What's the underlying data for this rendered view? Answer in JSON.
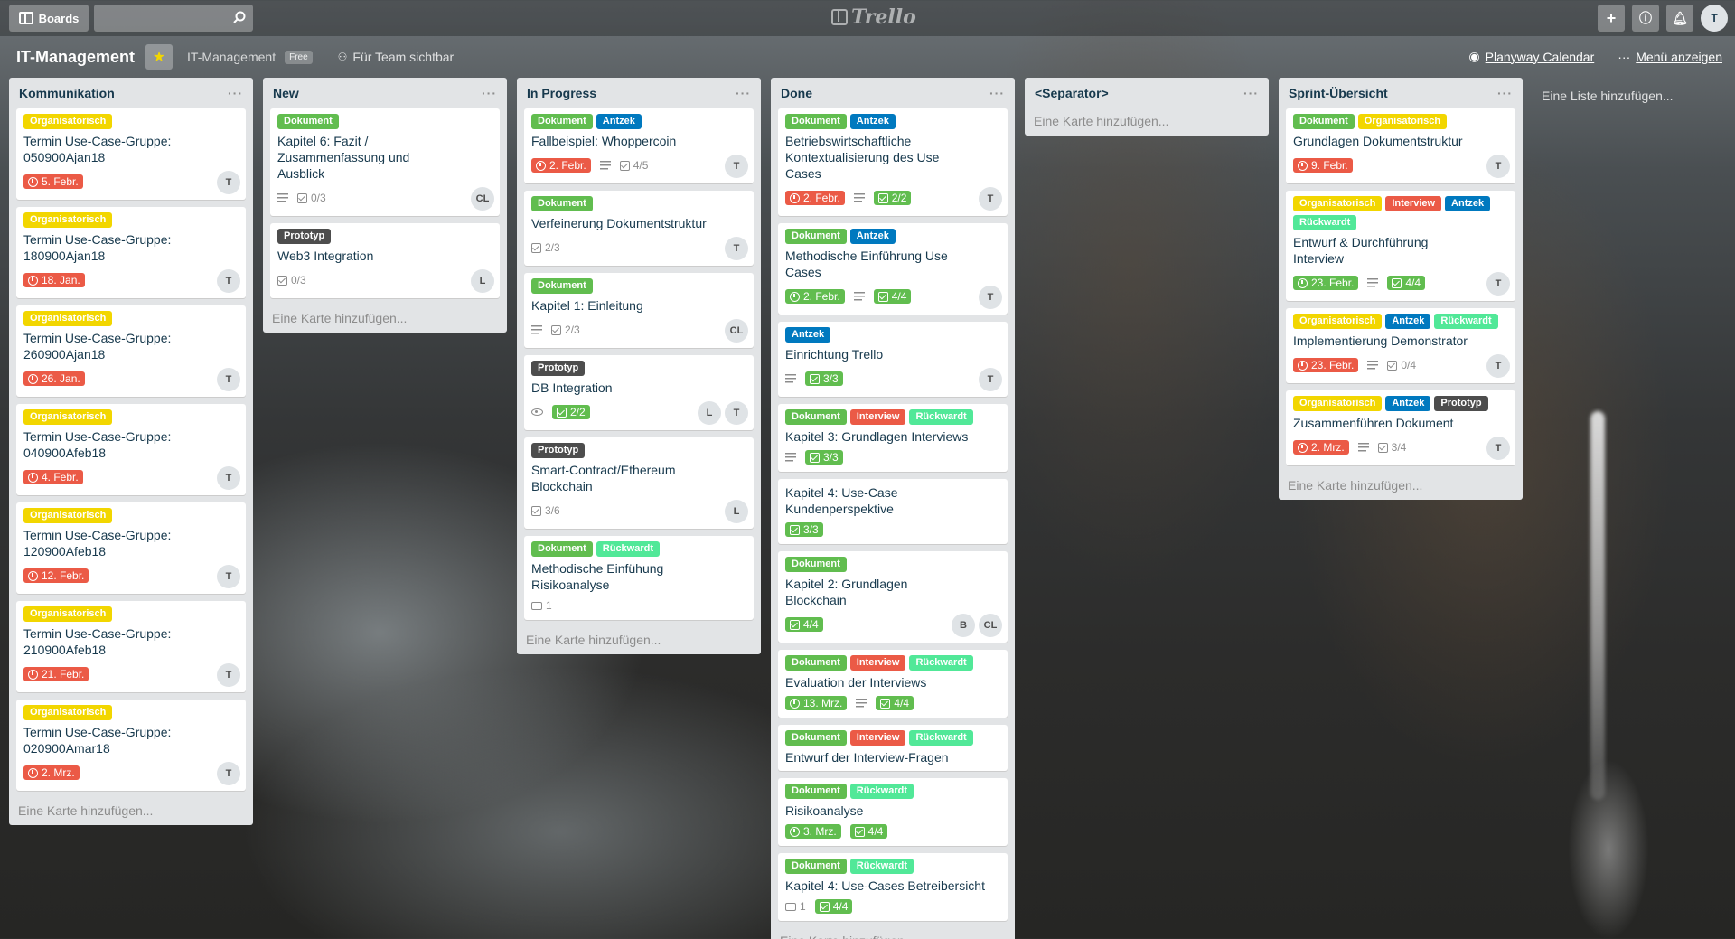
{
  "header": {
    "boards_label": "Boards",
    "search_placeholder": "",
    "logo_text": "Trello",
    "avatar": "T"
  },
  "board": {
    "title": "IT-Management",
    "team": "IT-Management",
    "plan": "Free",
    "visibility": "Für Team sichtbar",
    "planyway": "Planyway Calendar",
    "menu": "Menü anzeigen",
    "add_list": "Eine Liste hinzufügen..."
  },
  "lists": [
    {
      "title": "Kommunikation",
      "add_card": "Eine Karte hinzufügen...",
      "cards": [
        {
          "labels": [
            [
              "Organisatorisch",
              "yellow"
            ]
          ],
          "title": "Termin Use-Case-Gruppe: 050900Ajan18",
          "due": "5. Febr.",
          "members": [
            "T"
          ]
        },
        {
          "labels": [
            [
              "Organisatorisch",
              "yellow"
            ]
          ],
          "title": "Termin Use-Case-Gruppe: 180900Ajan18",
          "due": "18. Jan.",
          "members": [
            "T"
          ]
        },
        {
          "labels": [
            [
              "Organisatorisch",
              "yellow"
            ]
          ],
          "title": "Termin Use-Case-Gruppe: 260900Ajan18",
          "due": "26. Jan.",
          "members": [
            "T"
          ]
        },
        {
          "labels": [
            [
              "Organisatorisch",
              "yellow"
            ]
          ],
          "title": "Termin Use-Case-Gruppe: 040900Afeb18",
          "due": "4. Febr.",
          "members": [
            "T"
          ]
        },
        {
          "labels": [
            [
              "Organisatorisch",
              "yellow"
            ]
          ],
          "title": "Termin Use-Case-Gruppe: 120900Afeb18",
          "due": "12. Febr.",
          "members": [
            "T"
          ]
        },
        {
          "labels": [
            [
              "Organisatorisch",
              "yellow"
            ]
          ],
          "title": "Termin Use-Case-Gruppe: 210900Afeb18",
          "due": "21. Febr.",
          "members": [
            "T"
          ]
        },
        {
          "labels": [
            [
              "Organisatorisch",
              "yellow"
            ]
          ],
          "title": "Termin Use-Case-Gruppe: 020900Amar18",
          "due": "2. Mrz.",
          "members": [
            "T"
          ]
        }
      ]
    },
    {
      "title": "New",
      "add_card": "Eine Karte hinzufügen...",
      "cards": [
        {
          "labels": [
            [
              "Dokument",
              "green"
            ]
          ],
          "title": "Kapitel 6: Fazit / Zusammenfassung und Ausblick",
          "desc": true,
          "checklist": "0/3",
          "members": [
            "CL"
          ]
        },
        {
          "labels": [
            [
              "Prototyp",
              "black"
            ]
          ],
          "title": "Web3 Integration",
          "checklist": "0/3",
          "members": [
            "L"
          ]
        }
      ]
    },
    {
      "title": "In Progress",
      "add_card": "Eine Karte hinzufügen...",
      "cards": [
        {
          "labels": [
            [
              "Dokument",
              "green"
            ],
            [
              "Antzek",
              "blue"
            ]
          ],
          "title": "Fallbeispiel: Whoppercoin",
          "due": "2. Febr.",
          "desc": true,
          "checklist": "4/5",
          "members": [
            "T"
          ]
        },
        {
          "labels": [
            [
              "Dokument",
              "green"
            ]
          ],
          "title": "Verfeinerung Dokumentstruktur",
          "checklist": "2/3",
          "members": [
            "T"
          ]
        },
        {
          "labels": [
            [
              "Dokument",
              "green"
            ]
          ],
          "title": "Kapitel 1: Einleitung",
          "desc": true,
          "checklist": "2/3",
          "members": [
            "CL"
          ]
        },
        {
          "labels": [
            [
              "Prototyp",
              "black"
            ]
          ],
          "title": "DB Integration",
          "watch": true,
          "checklist": "2/2",
          "checklist_done": true,
          "members": [
            "L",
            "T"
          ]
        },
        {
          "labels": [
            [
              "Prototyp",
              "black"
            ]
          ],
          "title": "Smart-Contract/Ethereum Blockchain",
          "checklist": "3/6",
          "members": [
            "L"
          ]
        },
        {
          "labels": [
            [
              "Dokument",
              "green"
            ],
            [
              "Rückwardt",
              "lime"
            ]
          ],
          "title": "Methodische Einfühung Risikoanalyse",
          "comments": "1",
          "members": []
        }
      ]
    },
    {
      "title": "Done",
      "add_card": "Eine Karte hinzufügen...",
      "cards": [
        {
          "labels": [
            [
              "Dokument",
              "green"
            ],
            [
              "Antzek",
              "blue"
            ]
          ],
          "title": "Betriebswirtschaftliche Kontextualisierung des Use Cases",
          "due": "2. Febr.",
          "desc": true,
          "checklist": "2/2",
          "checklist_done": true,
          "members": [
            "T"
          ]
        },
        {
          "labels": [
            [
              "Dokument",
              "green"
            ],
            [
              "Antzek",
              "blue"
            ]
          ],
          "title": "Methodische Einführung Use Cases",
          "due": "2. Febr.",
          "due_done": true,
          "desc": true,
          "checklist": "4/4",
          "checklist_done": true,
          "members": [
            "T"
          ]
        },
        {
          "labels": [
            [
              "Antzek",
              "blue"
            ]
          ],
          "title": "Einrichtung Trello",
          "desc": true,
          "checklist": "3/3",
          "checklist_done": true,
          "members": [
            "T"
          ]
        },
        {
          "labels": [
            [
              "Dokument",
              "green"
            ],
            [
              "Interview",
              "red"
            ],
            [
              "Rückwardt",
              "lime"
            ]
          ],
          "title": "Kapitel 3: Grundlagen Interviews",
          "desc": true,
          "checklist": "3/3",
          "checklist_done": true,
          "members": []
        },
        {
          "labels": [],
          "title": "Kapitel 4: Use-Case Kundenperspektive",
          "checklist": "3/3",
          "checklist_done": true,
          "members": []
        },
        {
          "labels": [
            [
              "Dokument",
              "green"
            ]
          ],
          "title": "Kapitel 2: Grundlagen Blockchain",
          "checklist": "4/4",
          "checklist_done": true,
          "members": [
            "B",
            "CL"
          ]
        },
        {
          "labels": [
            [
              "Dokument",
              "green"
            ],
            [
              "Interview",
              "red"
            ],
            [
              "Rückwardt",
              "lime"
            ]
          ],
          "title": "Evaluation der Interviews",
          "due": "13. Mrz.",
          "due_done": true,
          "desc": true,
          "checklist": "4/4",
          "checklist_done": true,
          "members": []
        },
        {
          "labels": [
            [
              "Dokument",
              "green"
            ],
            [
              "Interview",
              "red"
            ],
            [
              "Rückwardt",
              "lime"
            ]
          ],
          "title": "Entwurf der Interview-Fragen",
          "members": []
        },
        {
          "labels": [
            [
              "Dokument",
              "green"
            ],
            [
              "Rückwardt",
              "lime"
            ]
          ],
          "title": "Risikoanalyse",
          "due": "3. Mrz.",
          "due_done": true,
          "checklist": "4/4",
          "checklist_done": true,
          "members": []
        },
        {
          "labels": [
            [
              "Dokument",
              "green"
            ],
            [
              "Rückwardt",
              "lime"
            ]
          ],
          "title": "Kapitel 4: Use-Cases Betreibersicht",
          "comments": "1",
          "checklist": "4/4",
          "checklist_done": true,
          "members": []
        }
      ]
    },
    {
      "title": "<Separator>",
      "add_card": "Eine Karte hinzufügen...",
      "cards": []
    },
    {
      "title": "Sprint-Übersicht",
      "add_card": "Eine Karte hinzufügen...",
      "cards": [
        {
          "labels": [
            [
              "Dokument",
              "green"
            ],
            [
              "Organisatorisch",
              "yellow"
            ]
          ],
          "title": "Grundlagen Dokumentstruktur",
          "due": "9. Febr.",
          "members": [
            "T"
          ]
        },
        {
          "labels": [
            [
              "Organisatorisch",
              "yellow"
            ],
            [
              "Interview",
              "red"
            ],
            [
              "Antzek",
              "blue"
            ],
            [
              "Rückwardt",
              "lime"
            ]
          ],
          "title": "Entwurf & Durchführung Interview",
          "due": "23. Febr.",
          "due_done": true,
          "desc": true,
          "checklist": "4/4",
          "checklist_done": true,
          "members": [
            "T"
          ]
        },
        {
          "labels": [
            [
              "Organisatorisch",
              "yellow"
            ],
            [
              "Antzek",
              "blue"
            ],
            [
              "Rückwardt",
              "lime"
            ]
          ],
          "title": "Implementierung Demonstrator",
          "due": "23. Febr.",
          "desc": true,
          "checklist": "0/4",
          "members": [
            "T"
          ]
        },
        {
          "labels": [
            [
              "Organisatorisch",
              "yellow"
            ],
            [
              "Antzek",
              "blue"
            ],
            [
              "Prototyp",
              "black"
            ]
          ],
          "title": "Zusammenführen Dokument",
          "due": "2. Mrz.",
          "desc": true,
          "checklist": "3/4",
          "members": [
            "T"
          ]
        }
      ]
    }
  ]
}
